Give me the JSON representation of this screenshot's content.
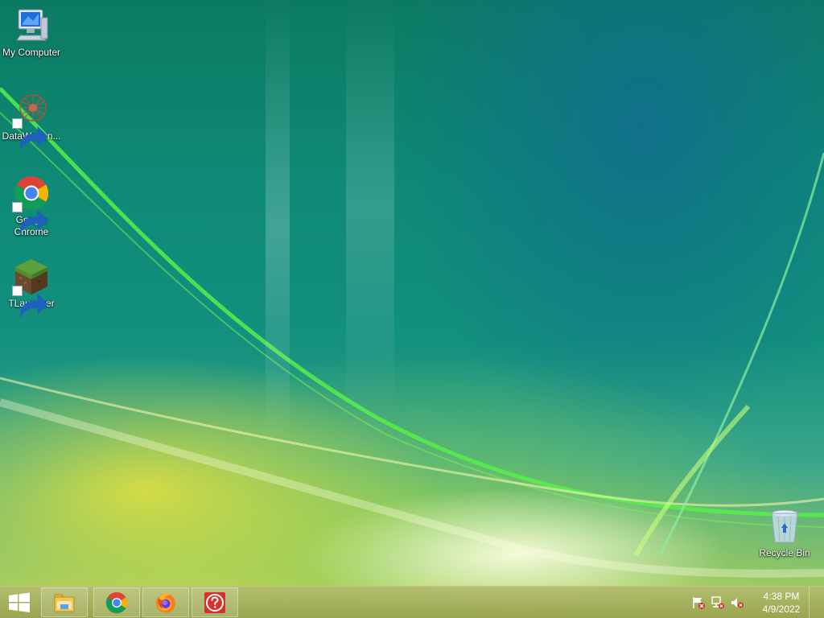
{
  "desktop": {
    "icons": [
      {
        "label": "My Computer",
        "icon": "computer-icon"
      },
      {
        "label": "DataWagon...",
        "icon": "datawagon-icon"
      },
      {
        "label": "Google Chrome",
        "icon": "chrome-icon"
      },
      {
        "label": "TLauncher",
        "icon": "minecraft-block-icon"
      },
      {
        "label": "Recycle Bin",
        "icon": "recycle-bin-icon"
      }
    ]
  },
  "taskbar": {
    "start_icon": "windows-logo-icon",
    "pinned": [
      {
        "name": "File Explorer",
        "icon": "file-explorer-icon"
      },
      {
        "name": "Google Chrome",
        "icon": "chrome-icon"
      },
      {
        "name": "Firefox",
        "icon": "firefox-icon"
      },
      {
        "name": "Help",
        "icon": "help-icon"
      }
    ],
    "tray": {
      "icons": [
        "action-center-flag-icon",
        "network-icon",
        "volume-muted-icon"
      ],
      "time": "4:38 PM",
      "date": "4/9/2022"
    }
  },
  "colors": {
    "taskbar": "#a4ad64",
    "wallpaper_teal": "#0e8a76",
    "wallpaper_yellow": "#d6d84a",
    "accent_green": "#3de04a"
  }
}
